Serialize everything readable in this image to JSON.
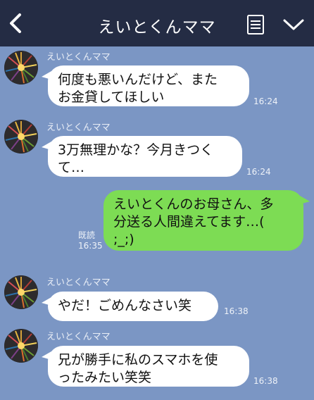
{
  "header": {
    "title": "えいとくんママ",
    "back_icon": "chevron-left-icon",
    "menu_icon": "notes-list-icon",
    "more_icon": "chevron-down-icon"
  },
  "messages": [
    {
      "direction": "incoming",
      "sender": "えいとくんママ",
      "text": "何度も悪いんだけど、また\nお金貸してほしい",
      "time": "16:24"
    },
    {
      "direction": "incoming",
      "sender": "えいとくんママ",
      "text": "3万無理かな？今月きつく\nて…",
      "time": "16:24"
    },
    {
      "direction": "outgoing",
      "text": "えいとくんのお母さん、多\n分送る人間違えてます…(\n;_;)",
      "read_label": "既読",
      "time": "16:35"
    },
    {
      "direction": "incoming",
      "sender": "えいとくんママ",
      "text": "やだ！ごめんなさい笑",
      "time": "16:38"
    },
    {
      "direction": "incoming",
      "sender": "えいとくんママ",
      "text": "兄が勝手に私のスマホを使\nったみたい笑笑",
      "time": "16:38"
    }
  ],
  "colors": {
    "header_bg": "#242c44",
    "chat_bg": "#7b96c4",
    "incoming_bubble": "#ffffff",
    "outgoing_bubble": "#7ddc54",
    "meta_text": "#eef2f8"
  }
}
